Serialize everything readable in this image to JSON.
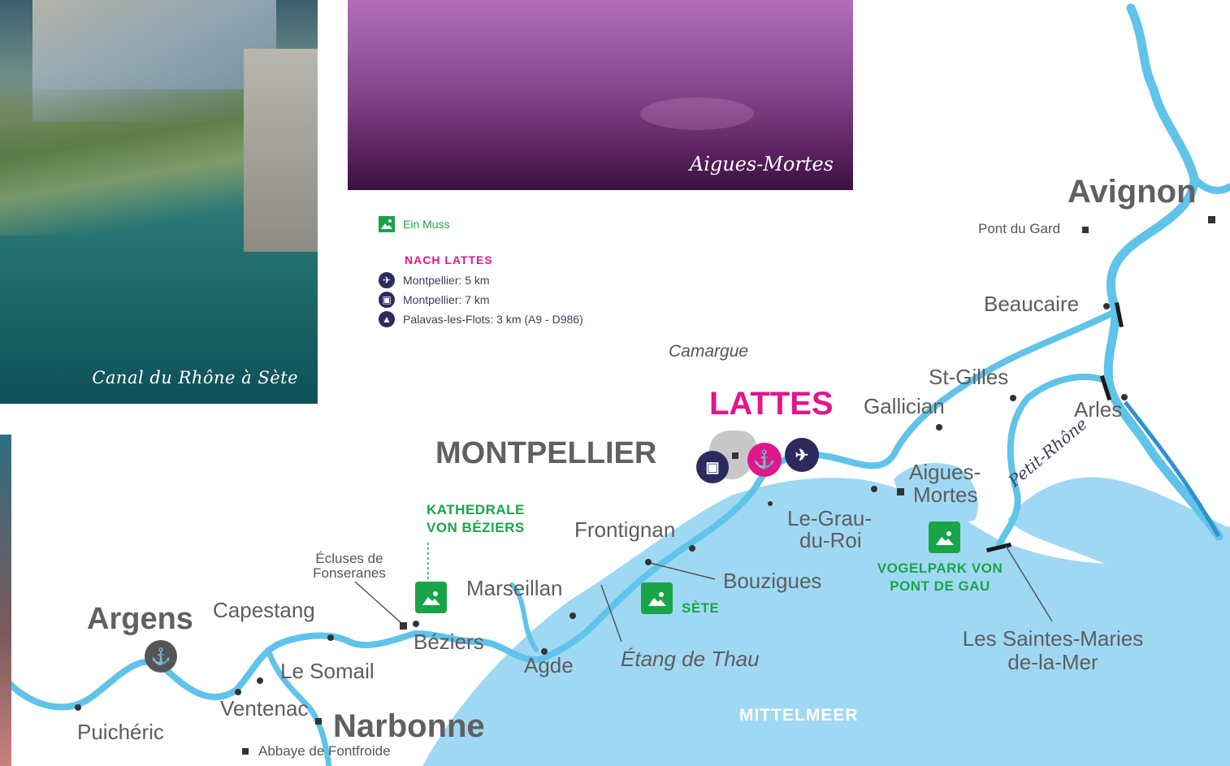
{
  "photos": {
    "canal_caption": "Canal du Rhône à Sète",
    "aigues_caption": "Aigues-Mortes"
  },
  "legend": {
    "must_label": "Ein Muss",
    "heading": "NACH LATTES",
    "airport": "Montpellier: 5 km",
    "train": "Montpellier: 7 km",
    "road": "Palavas-les-Flots: 3 km (A9 - D986)"
  },
  "places": {
    "avignon": "Avignon",
    "pont_du_gard": "Pont du Gard",
    "beaucaire": "Beaucaire",
    "camargue": "Camargue",
    "st_gilles": "St-Gilles",
    "lattes": "LATTES",
    "gallician": "Gallician",
    "arles": "Arles",
    "montpellier": "MONTPELLIER",
    "aigues_mortes_1": "Aigues-",
    "aigues_mortes_2": "Mortes",
    "petit_rhone": "Petit-Rhône",
    "le_grau_1": "Le-Grau-",
    "le_grau_2": "du-Roi",
    "frontignan": "Frontignan",
    "kathedrale_1": "KATHEDRALE",
    "kathedrale_2": "VON BÉZIERS",
    "vogelpark_1": "VOGELPARK VON",
    "vogelpark_2": "PONT DE GAU",
    "ecluses_1": "Écluses de",
    "ecluses_2": "Fonseranes",
    "marseillan": "Marseillan",
    "bouzigues": "Bouzigues",
    "sete": "SÈTE",
    "argens": "Argens",
    "capestang": "Capestang",
    "beziers": "Béziers",
    "saintes_1": "Les Saintes-Maries",
    "saintes_2": "de-la-Mer",
    "le_somail": "Le Somail",
    "agde": "Agde",
    "etang": "Étang de Thau",
    "ventenac": "Ventenac",
    "narbonne": "Narbonne",
    "mittelmeer": "MITTELMEER",
    "puicheric": "Puichéric",
    "abbaye": "Abbaye de Fontfroide"
  },
  "colors": {
    "water": "#9fd8f3",
    "river": "#5fc3ea",
    "land": "#ffffff",
    "magenta": "#e0168b",
    "navy": "#2d2a5e",
    "green": "#1aa44a",
    "grey_city": "#c8c8c8"
  },
  "icons": {
    "must": "landscape-icon",
    "airport": "airplane-icon",
    "train": "train-icon",
    "road": "road-icon",
    "port": "anchor-icon"
  }
}
